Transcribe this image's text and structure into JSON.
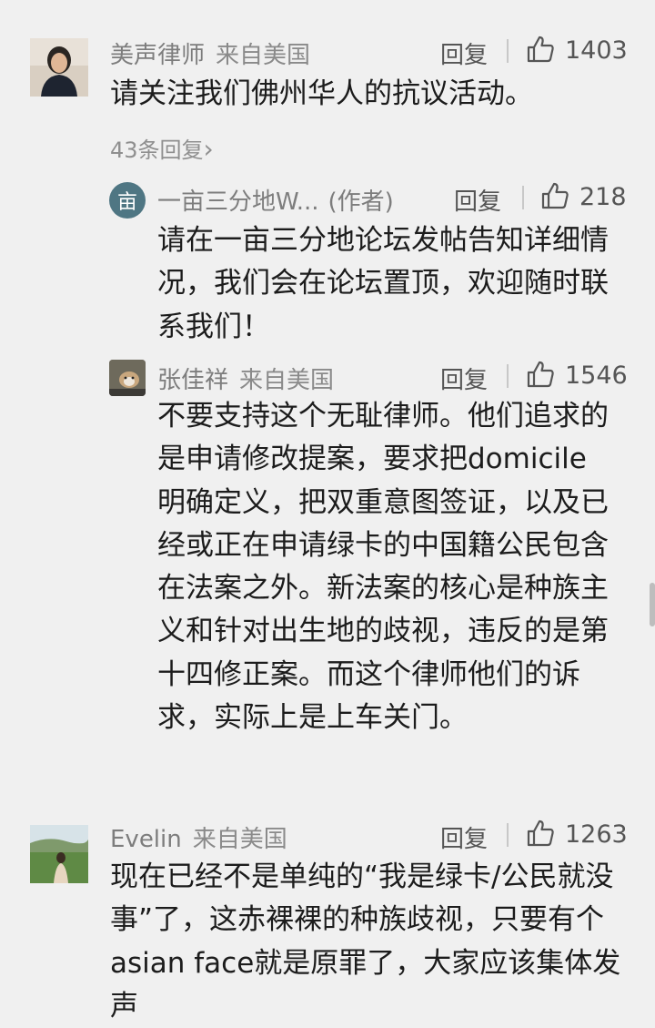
{
  "comments": [
    {
      "username": "美声律师",
      "location": "来自美国",
      "reply_label": "回复",
      "likes": "1403",
      "text": "请关注我们佛州华人的抗议活动。",
      "replies_link": "43条回复",
      "replies_chevron": "›"
    },
    {
      "username": "一亩三分地W...",
      "author_tag": "(作者)",
      "avatar_char": "亩",
      "reply_label": "回复",
      "likes": "218",
      "text": "请在一亩三分地论坛发帖告知详细情况，我们会在论坛置顶，欢迎随时联系我们！"
    },
    {
      "username": "张佳祥",
      "location": "来自美国",
      "reply_label": "回复",
      "likes": "1546",
      "text": "不要支持这个无耻律师。他们追求的是申请修改提案，要求把domicile明确定义，把双重意图签证，以及已经或正在申请绿卡的中国籍公民包含在法案之外。新法案的核心是种族主义和针对出生地的歧视，违反的是第十四修正案。而这个律师他们的诉求，实际上是上车关门。"
    },
    {
      "username": "Evelin",
      "location": "来自美国",
      "reply_label": "回复",
      "likes": "1263",
      "text": "现在已经不是单纯的“我是绿卡/公民就没事”了，这赤裸裸的种族歧视，只要有个asian face就是原罪了，大家应该集体发声"
    }
  ],
  "icons": {
    "like": "thumbs-up-icon",
    "avatar_bg_author": "#4f7683"
  }
}
